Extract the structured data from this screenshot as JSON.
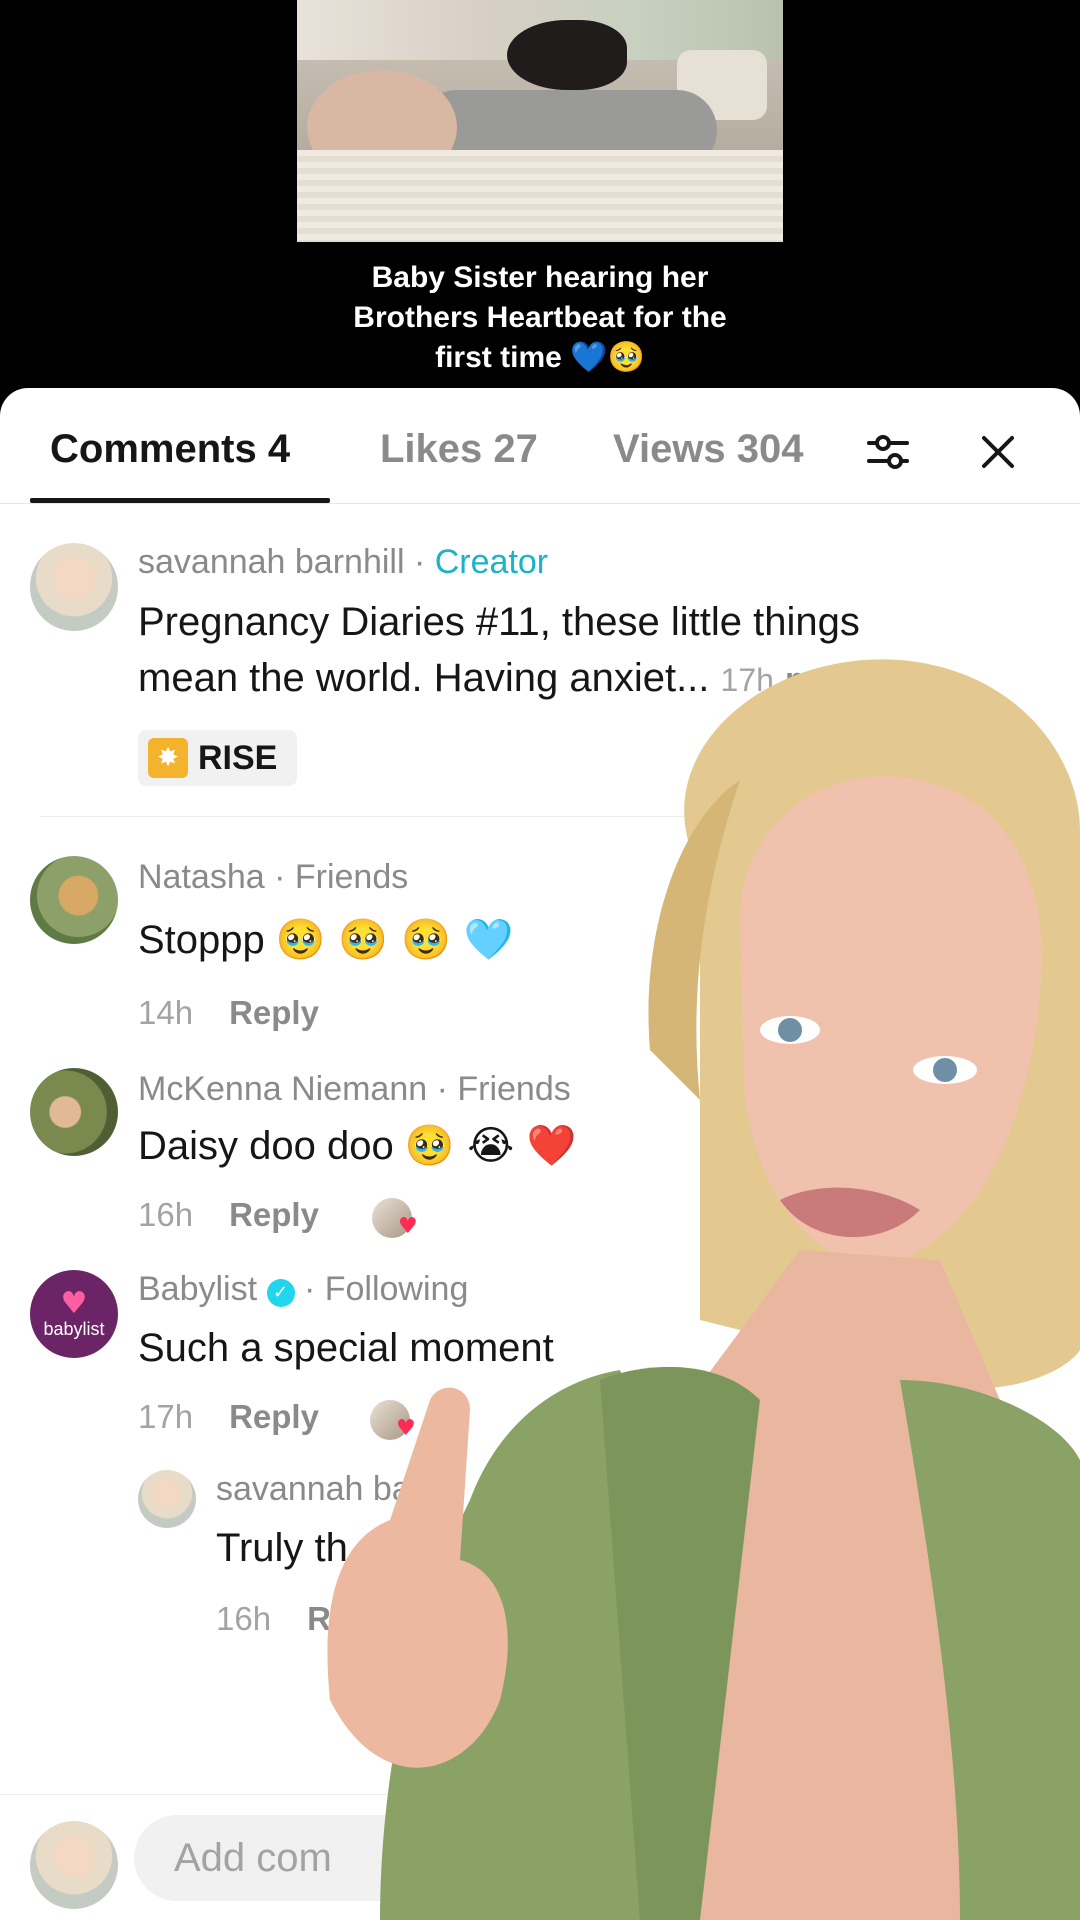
{
  "video": {
    "caption_line1": "Baby Sister hearing her",
    "caption_line2": "Brothers Heartbeat for the",
    "caption_line3": "first time",
    "caption_emoji": "💙🥹"
  },
  "tabs": {
    "comments": "Comments 4",
    "likes": "Likes 27",
    "views": "Views 304"
  },
  "icons": {
    "filter": "filter-sliders-icon",
    "close": "close-icon"
  },
  "comments": [
    {
      "author": "savannah barnhill",
      "separator": " · ",
      "tag": "Creator",
      "line1": "Pregnancy Diaries #11, these little things",
      "line2": "mean the world. Having anxiet...",
      "time": "17h",
      "more": "more",
      "badge": "RISE"
    },
    {
      "author": "Natasha",
      "tag": " · Friends",
      "text": "Stoppp",
      "emoji": "🥹 🥹 🥹 🩵",
      "time": "14h",
      "reply": "Reply"
    },
    {
      "author": "McKenna Niemann",
      "tag": " · Friends",
      "text": "Daisy doo doo",
      "emoji": "🥹 😭 ❤️",
      "time": "16h",
      "reply": "Reply"
    },
    {
      "author": "Babylist",
      "avatar_text": "babylist",
      "tag": " · Following",
      "text": "Such a special moment",
      "time": "17h",
      "reply": "Reply"
    },
    {
      "author": "savannah barnl",
      "text": "Truly th",
      "time": "16h",
      "reply": "R"
    }
  ],
  "input": {
    "placeholder": "Add com"
  },
  "colors": {
    "creator_tag": "#1ab3c7",
    "heart": "#fe2c55",
    "babylist_bg": "#6b2466",
    "rise_badge": "#f4b32c"
  }
}
